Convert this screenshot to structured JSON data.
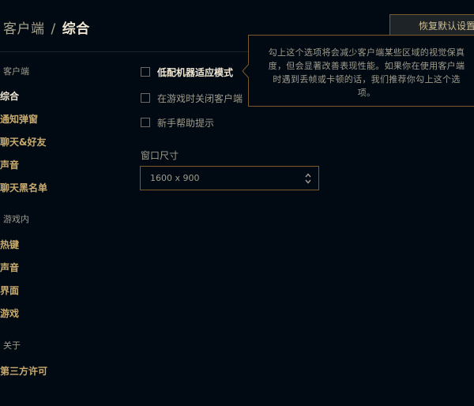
{
  "header": {
    "breadcrumb_parent": "客户端",
    "breadcrumb_separator": "/",
    "breadcrumb_current": "综合",
    "reset_label": "恢复默认设置"
  },
  "sidebar": {
    "sections": [
      {
        "title": "客户端",
        "items": [
          {
            "label": "综合",
            "active": true
          },
          {
            "label": "通知弹窗",
            "active": false
          },
          {
            "label": "聊天&好友",
            "active": false
          },
          {
            "label": "声音",
            "active": false
          },
          {
            "label": "聊天黑名单",
            "active": false
          }
        ]
      },
      {
        "title": "游戏内",
        "items": [
          {
            "label": "热键",
            "active": false
          },
          {
            "label": "声音",
            "active": false
          },
          {
            "label": "界面",
            "active": false
          },
          {
            "label": "游戏",
            "active": false
          }
        ]
      },
      {
        "title": "关于",
        "items": [
          {
            "label": "第三方许可",
            "active": false
          }
        ]
      }
    ]
  },
  "options": [
    {
      "label": "低配机器适应模式",
      "checked": false
    },
    {
      "label": "在游戏时关闭客户端",
      "checked": false
    },
    {
      "label": "新手帮助提示",
      "checked": false
    }
  ],
  "window_size": {
    "label": "窗口尺寸",
    "value": "1600 x 900"
  },
  "tooltip": {
    "lines": [
      "勾上这个选项将会减少客户端某些区域的视觉保真",
      "度，但会显著改善表现性能。如果你在使用客户端",
      "时遇到丢帧或卡顿的话，我们推荐你勾上这个选",
      "项。"
    ]
  },
  "colors": {
    "background": "#010a13",
    "gold_border": "#785a28",
    "gold_text": "#c8aa6e",
    "light_text": "#f0e6d2",
    "muted_text": "#a09b8c"
  }
}
